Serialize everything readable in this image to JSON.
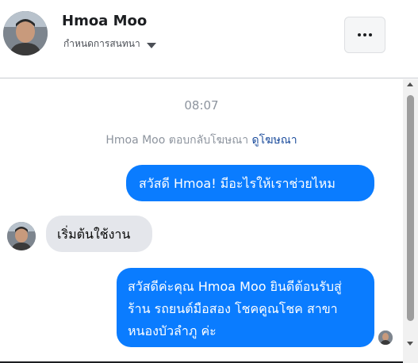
{
  "header": {
    "contact_name": "Hmoa Moo",
    "subtitle": "กำหนดการสนทนา",
    "more_icon": "more-horizontal-icon"
  },
  "chat": {
    "timestamp": "08:07",
    "ad_reply_text": "Hmoa Moo ตอบกลับโฆษณา",
    "ad_link_label": "ดูโฆษณา",
    "messages": [
      {
        "direction": "outgoing",
        "text": "สวัสดี Hmoa! มีอะไรให้เราช่วยไหม"
      },
      {
        "direction": "incoming",
        "text": "เริ่มต้นใช้งาน"
      },
      {
        "direction": "outgoing",
        "text": "สวัสดีค่ะคุณ Hmoa Moo ยินดีต้อนรับสู่ร้าน รถยนต์มือสอง โชคคูณโชค สาขาหนองบัวลำภู ค่ะ"
      }
    ]
  },
  "colors": {
    "outgoing_bubble": "#0a7cff",
    "incoming_bubble": "#e4e6eb",
    "link": "#1b4c9c",
    "muted_text": "#8d949e"
  }
}
